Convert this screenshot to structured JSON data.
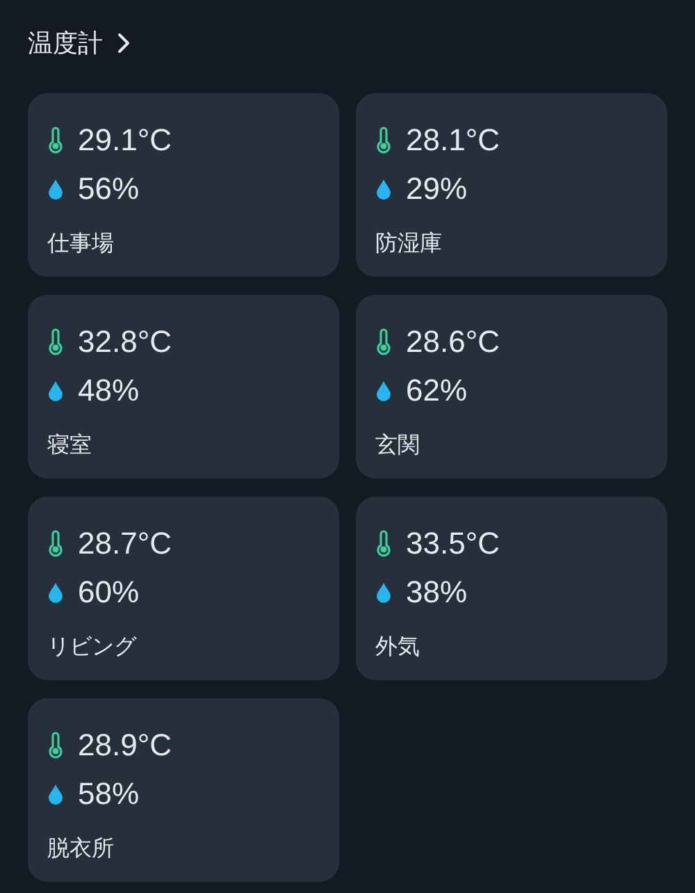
{
  "title": "温度計",
  "sensors": [
    {
      "temperature": "29.1°C",
      "humidity": "56%",
      "name": "仕事場"
    },
    {
      "temperature": "28.1°C",
      "humidity": "29%",
      "name": "防湿庫"
    },
    {
      "temperature": "32.8°C",
      "humidity": "48%",
      "name": "寝室"
    },
    {
      "temperature": "28.6°C",
      "humidity": "62%",
      "name": "玄関"
    },
    {
      "temperature": "28.7°C",
      "humidity": "60%",
      "name": "リビング"
    },
    {
      "temperature": "33.5°C",
      "humidity": "38%",
      "name": "外気"
    },
    {
      "temperature": "28.9°C",
      "humidity": "58%",
      "name": "脱衣所"
    }
  ]
}
